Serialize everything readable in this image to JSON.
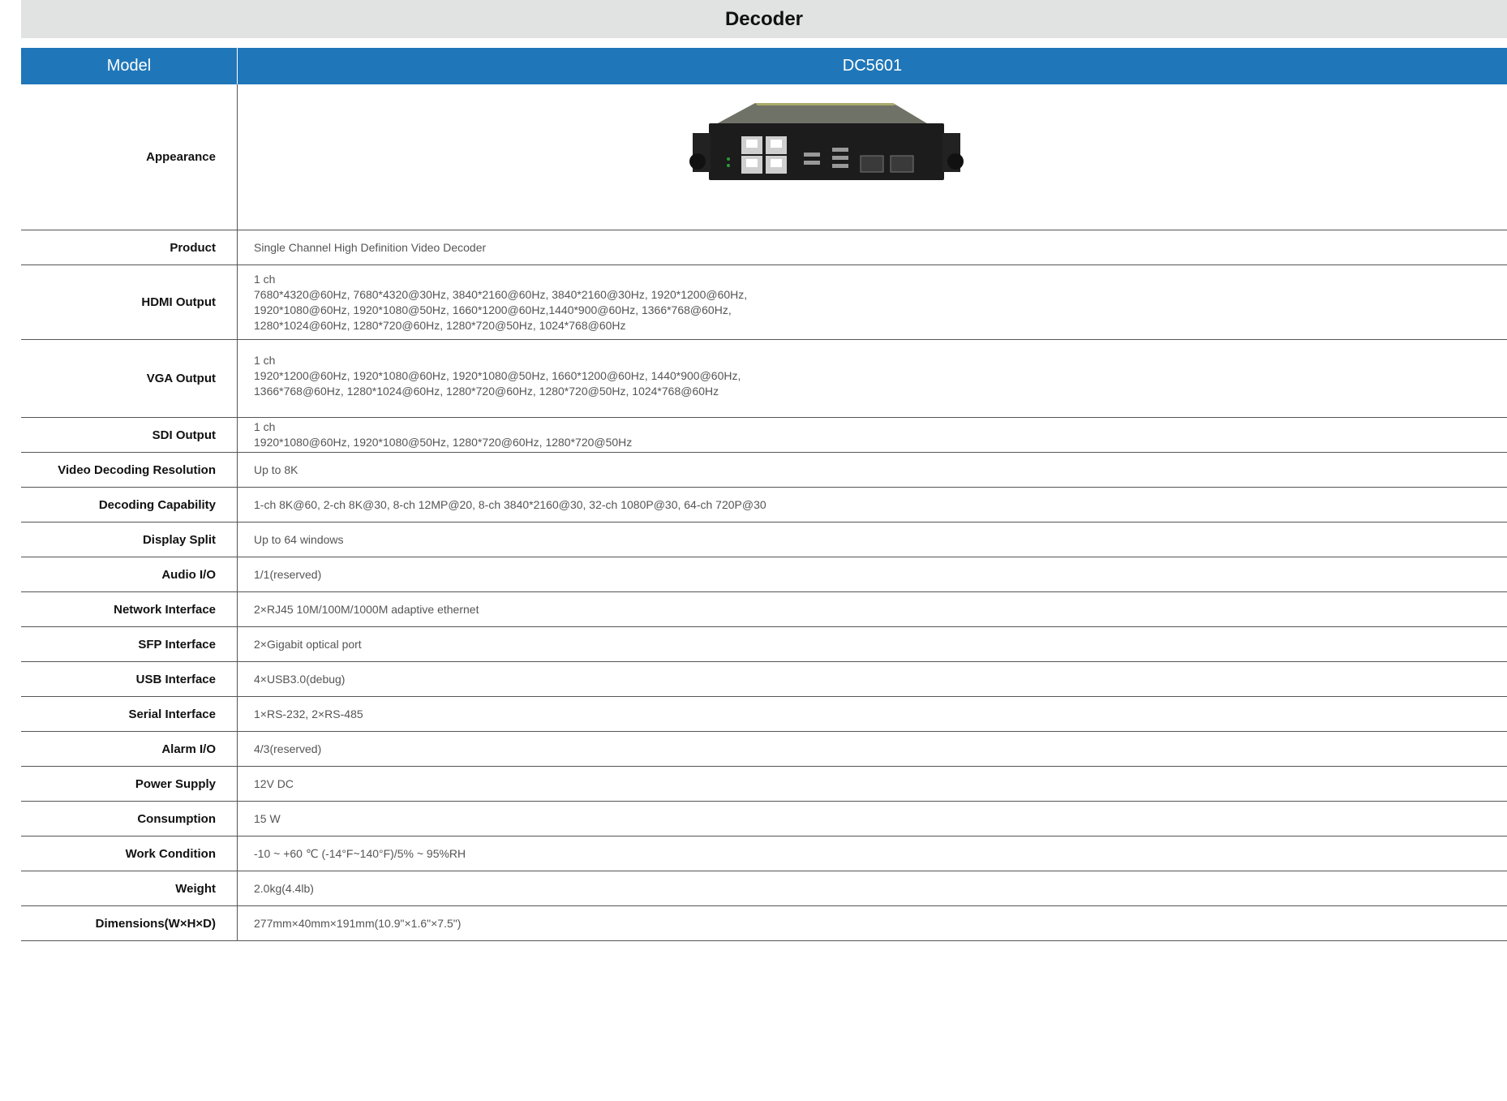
{
  "title": "Decoder",
  "header": {
    "label": "Model",
    "value": "DC5601"
  },
  "rows": [
    {
      "label": "Appearance"
    },
    {
      "label": "Product",
      "lines": [
        "Single Channel High Definition Video Decoder"
      ]
    },
    {
      "label": "HDMI Output",
      "lines": [
        "1 ch",
        "7680*4320@60Hz, 7680*4320@30Hz, 3840*2160@60Hz, 3840*2160@30Hz, 1920*1200@60Hz,",
        "1920*1080@60Hz, 1920*1080@50Hz, 1660*1200@60Hz,1440*900@60Hz, 1366*768@60Hz,",
        "1280*1024@60Hz, 1280*720@60Hz, 1280*720@50Hz, 1024*768@60Hz"
      ]
    },
    {
      "label": "VGA Output",
      "lines": [
        "1 ch",
        "1920*1200@60Hz, 1920*1080@60Hz, 1920*1080@50Hz, 1660*1200@60Hz, 1440*900@60Hz,",
        "1366*768@60Hz, 1280*1024@60Hz, 1280*720@60Hz, 1280*720@50Hz, 1024*768@60Hz"
      ]
    },
    {
      "label": "SDI Output",
      "lines": [
        "1 ch",
        "1920*1080@60Hz, 1920*1080@50Hz, 1280*720@60Hz, 1280*720@50Hz"
      ]
    },
    {
      "label": "Video Decoding Resolution",
      "lines": [
        "Up to 8K"
      ]
    },
    {
      "label": "Decoding Capability",
      "lines": [
        "1-ch 8K@60, 2-ch 8K@30, 8-ch 12MP@20, 8-ch 3840*2160@30, 32-ch 1080P@30, 64-ch 720P@30"
      ]
    },
    {
      "label": "Display Split",
      "lines": [
        "Up to 64 windows"
      ]
    },
    {
      "label": "Audio I/O",
      "lines": [
        "1/1(reserved)"
      ]
    },
    {
      "label": "Network Interface",
      "lines": [
        "2×RJ45 10M/100M/1000M adaptive ethernet"
      ]
    },
    {
      "label": "SFP Interface",
      "lines": [
        "2×Gigabit optical port"
      ]
    },
    {
      "label": "USB Interface",
      "lines": [
        "4×USB3.0(debug)"
      ]
    },
    {
      "label": "Serial Interface",
      "lines": [
        "1×RS-232, 2×RS-485"
      ]
    },
    {
      "label": "Alarm I/O",
      "lines": [
        "4/3(reserved)"
      ]
    },
    {
      "label": "Power Supply",
      "lines": [
        "12V DC"
      ]
    },
    {
      "label": "Consumption",
      "lines": [
        "15 W"
      ]
    },
    {
      "label": "Work Condition",
      "lines": [
        "-10 ~ +60 ℃ (-14°F~140°F)/5% ~ 95%RH"
      ]
    },
    {
      "label": "Weight",
      "lines": [
        "2.0kg(4.4lb)"
      ]
    },
    {
      "label": "Dimensions(W×H×D)",
      "lines": [
        "277mm×40mm×191mm(10.9\"×1.6\"×7.5\")"
      ]
    }
  ]
}
